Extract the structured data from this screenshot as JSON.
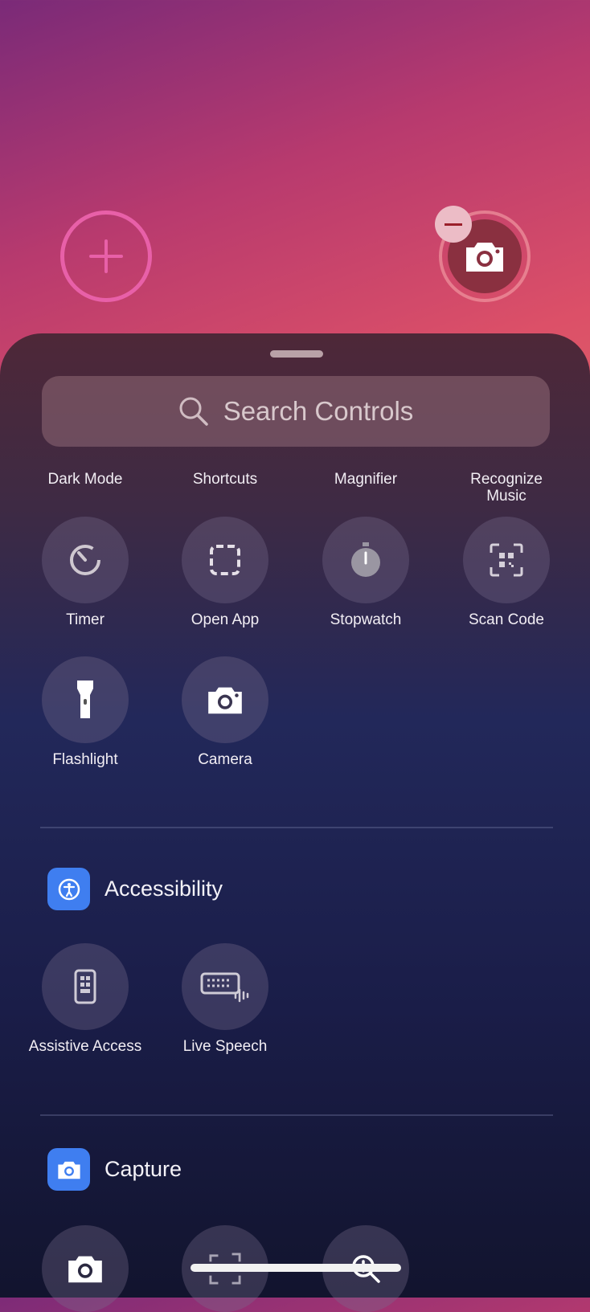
{
  "top": {
    "add_icon": "plus-icon",
    "active_control_icon": "camera-icon",
    "remove_icon": "minus-icon"
  },
  "search": {
    "placeholder": "Search Controls",
    "icon": "magnifying-glass-icon"
  },
  "row1": [
    {
      "label": "Dark Mode"
    },
    {
      "label": "Shortcuts"
    },
    {
      "label": "Magnifier"
    },
    {
      "label": "Recognize Music"
    }
  ],
  "row2": [
    {
      "label": "Timer",
      "icon": "timer-icon"
    },
    {
      "label": "Open App",
      "icon": "dashed-square-icon"
    },
    {
      "label": "Stopwatch",
      "icon": "stopwatch-icon"
    },
    {
      "label": "Scan Code",
      "icon": "qr-code-icon"
    }
  ],
  "row3": [
    {
      "label": "Flashlight",
      "icon": "flashlight-icon"
    },
    {
      "label": "Camera",
      "icon": "camera-icon"
    }
  ],
  "accessibility": {
    "title": "Accessibility",
    "icon": "accessibility-icon",
    "accent": "#3f7ef0",
    "items": [
      {
        "label": "Assistive Access",
        "icon": "assistive-access-icon"
      },
      {
        "label": "Live Speech",
        "icon": "keyboard-waveform-icon"
      }
    ]
  },
  "capture": {
    "title": "Capture",
    "icon": "camera-icon",
    "accent": "#3f7ef0"
  }
}
